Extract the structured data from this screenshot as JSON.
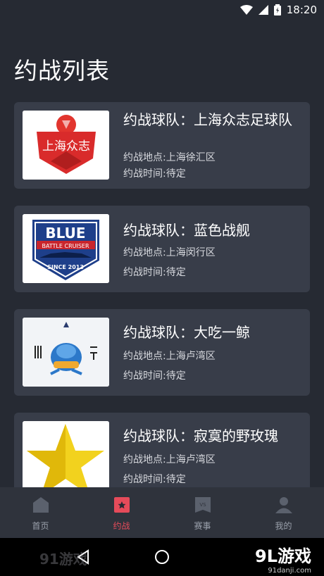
{
  "status": {
    "time": "18:20"
  },
  "page": {
    "title": "约战列表"
  },
  "matches": [
    {
      "team": "约战球队：上海众志足球队",
      "location": "约战地点:上海徐汇区",
      "time": "约战时间:待定",
      "logo_text": "上海众志"
    },
    {
      "team": "约战球队：蓝色战舰",
      "location": "约战地点:上海闵行区",
      "time": "约战时间:待定",
      "logo_text": "BLUE",
      "logo_sub": "BATTLE CRUISER",
      "logo_since": "SINCE 2013"
    },
    {
      "team": "约战球队：大吃一鲸",
      "location": "约战地点:上海卢湾区",
      "time": "约战时间:待定"
    },
    {
      "team": "约战球队：寂寞的野玫瑰",
      "location": "约战地点:上海卢湾区",
      "time": "约战时间:待定"
    }
  ],
  "tabs": [
    {
      "label": "首页",
      "icon": "home-icon"
    },
    {
      "label": "约战",
      "icon": "star-badge-icon"
    },
    {
      "label": "赛事",
      "icon": "vs-icon"
    },
    {
      "label": "我的",
      "icon": "user-icon"
    }
  ],
  "watermark": {
    "left": "91游戏",
    "right": "9L游戏",
    "right_url": "91danji.com"
  },
  "colors": {
    "background": "#262a33",
    "card": "#383d49",
    "active_tab": "#e64b5a"
  }
}
